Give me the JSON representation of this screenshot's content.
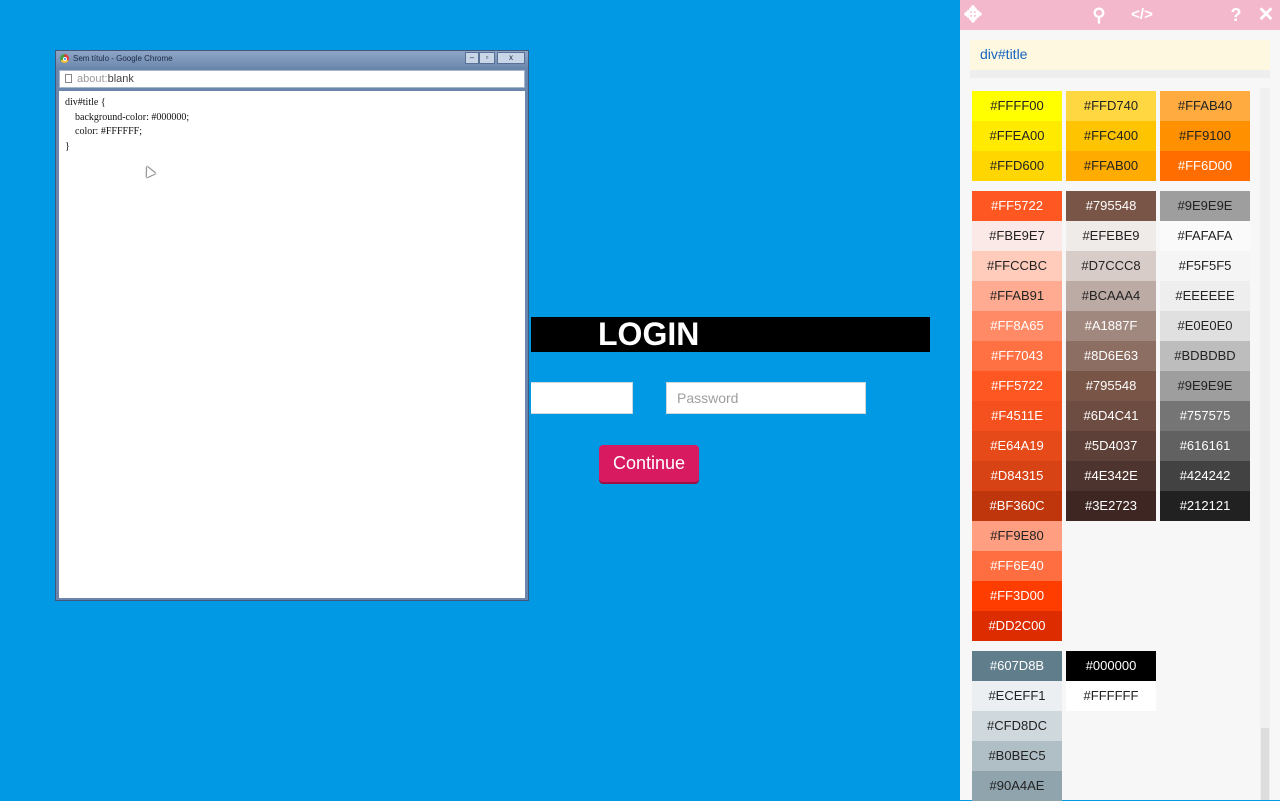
{
  "login": {
    "title": "LOGIN",
    "username_value": "",
    "password_placeholder": "Password",
    "continue_label": "Continue"
  },
  "chrome_window": {
    "title": "Sem título - Google Chrome",
    "min_glyph": "–",
    "max_glyph": "▫",
    "close_glyph": "x",
    "url_scheme": "about:",
    "url_page": "blank",
    "css_code": "div#title {\n    background-color: #000000;\n    color: #FFFFFF;\n}"
  },
  "picker": {
    "toolbar": {
      "move_glyph": "✥",
      "search_glyph": "⚲",
      "code_glyph": "</>",
      "help_glyph": "?",
      "close_glyph": "✕"
    },
    "selector": "div#title",
    "groups": [
      {
        "columns": [
          [
            "#FFFF00",
            "#FFEA00",
            "#FFD600"
          ],
          [
            "#FFD740",
            "#FFC400",
            "#FFAB00"
          ],
          [
            "#FFAB40",
            "#FF9100",
            "#FF6D00"
          ]
        ]
      },
      {
        "columns": [
          [
            "#FF5722",
            "#FBE9E7",
            "#FFCCBC",
            "#FFAB91",
            "#FF8A65",
            "#FF7043",
            "#FF5722",
            "#F4511E",
            "#E64A19",
            "#D84315",
            "#BF360C",
            "#FF9E80",
            "#FF6E40",
            "#FF3D00",
            "#DD2C00"
          ],
          [
            "#795548",
            "#EFEBE9",
            "#D7CCC8",
            "#BCAAA4",
            "#A1887F",
            "#8D6E63",
            "#795548",
            "#6D4C41",
            "#5D4037",
            "#4E342E",
            "#3E2723"
          ],
          [
            "#9E9E9E",
            "#FAFAFA",
            "#F5F5F5",
            "#EEEEEE",
            "#E0E0E0",
            "#BDBDBD",
            "#9E9E9E",
            "#757575",
            "#616161",
            "#424242",
            "#212121"
          ]
        ]
      },
      {
        "columns": [
          [
            "#607D8B",
            "#ECEFF1",
            "#CFD8DC",
            "#B0BEC5",
            "#90A4AE"
          ],
          [
            "#000000",
            "#FFFFFF"
          ]
        ]
      }
    ]
  }
}
